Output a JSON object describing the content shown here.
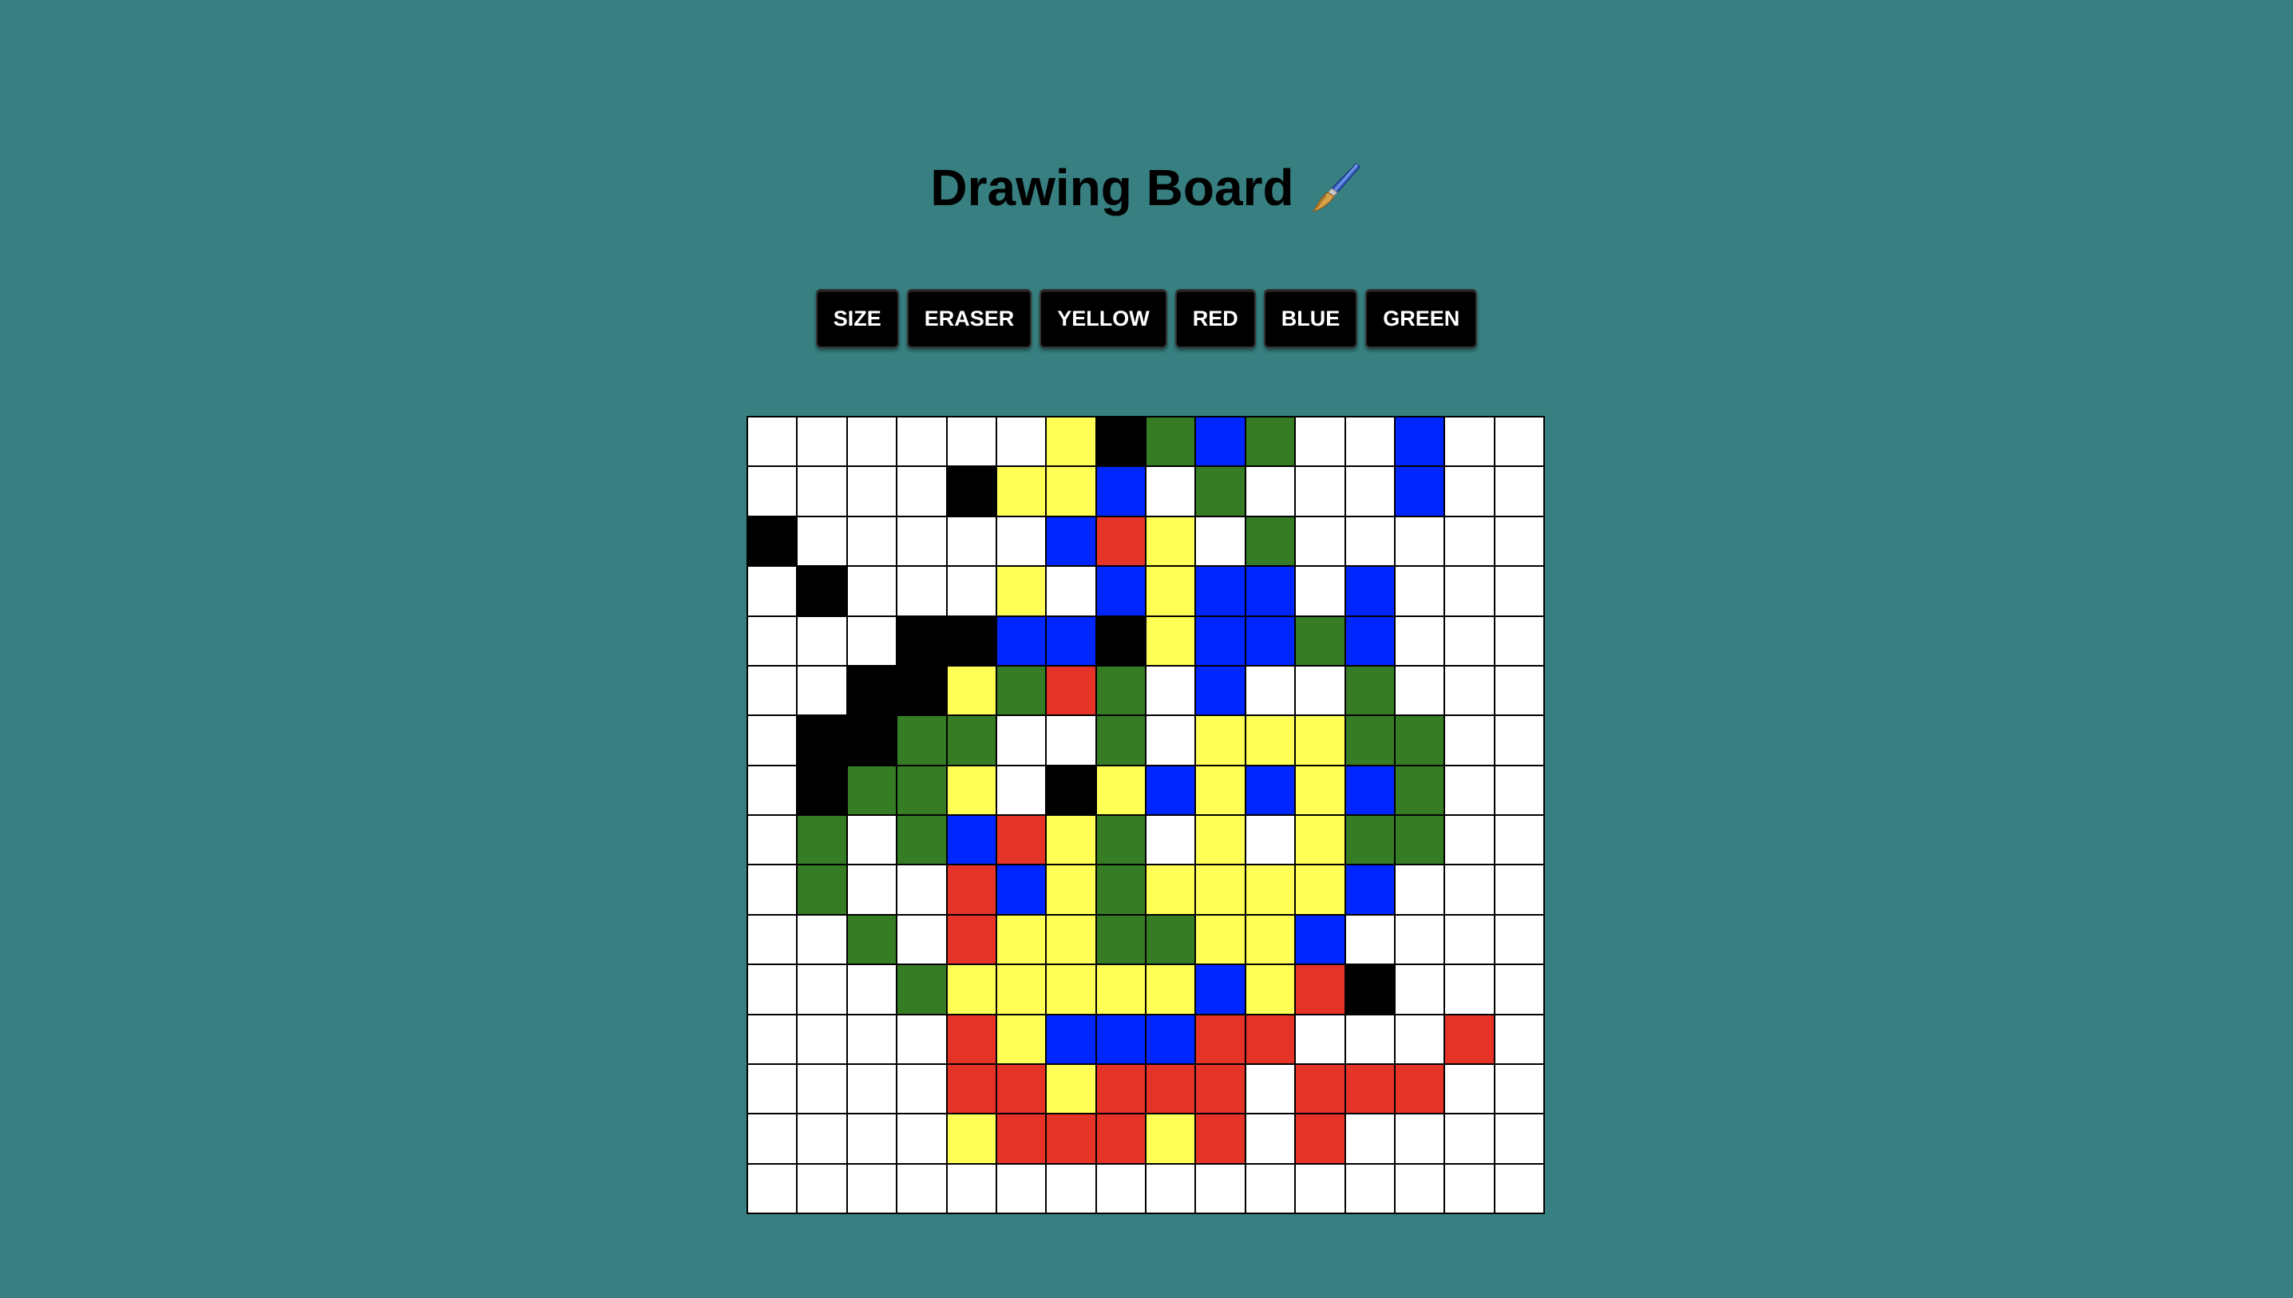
{
  "header": {
    "title": "Drawing Board",
    "icon": "paintbrush-icon"
  },
  "toolbar": {
    "buttons": [
      {
        "id": "size",
        "label": "SIZE"
      },
      {
        "id": "eraser",
        "label": "ERASER"
      },
      {
        "id": "yellow",
        "label": "YELLOW"
      },
      {
        "id": "red",
        "label": "RED"
      },
      {
        "id": "blue",
        "label": "BLUE"
      },
      {
        "id": "green",
        "label": "GREEN"
      }
    ]
  },
  "colors": {
    "background": "#377f80",
    "W": "#ffffff",
    "K": "#000000",
    "Y": "#ffff55",
    "R": "#e63327",
    "B": "#0026ff",
    "G": "#367c24"
  },
  "board": {
    "size": 16,
    "rows": [
      "WWWWWWYKGBGWWBWW",
      "WWWWKYYBWGWWWBWW",
      "KWWWWWBRYWGWWWWW",
      "WKWWWYWBYBBWBWWW",
      "WWWKKBBKYBBGBWWW",
      "WWKKYGRGWBWWGWWW",
      "WKKGGWWGWYYYGGWW",
      "WKGGYWKYBYBYBGWW",
      "WGWGBRYGWYWYGGWW",
      "WGWWRBYGYYYYBWWW",
      "WWGWRYYGGYYBWWWW",
      "WWWGYYYYYBYRKWWW",
      "WWWWRYBBBRRWWWRW",
      "WWWWRRYRRRWRRRWW",
      "WWWWYRRRYRWRWWWW",
      "WWWWWWWWWWWWWWWW"
    ]
  }
}
